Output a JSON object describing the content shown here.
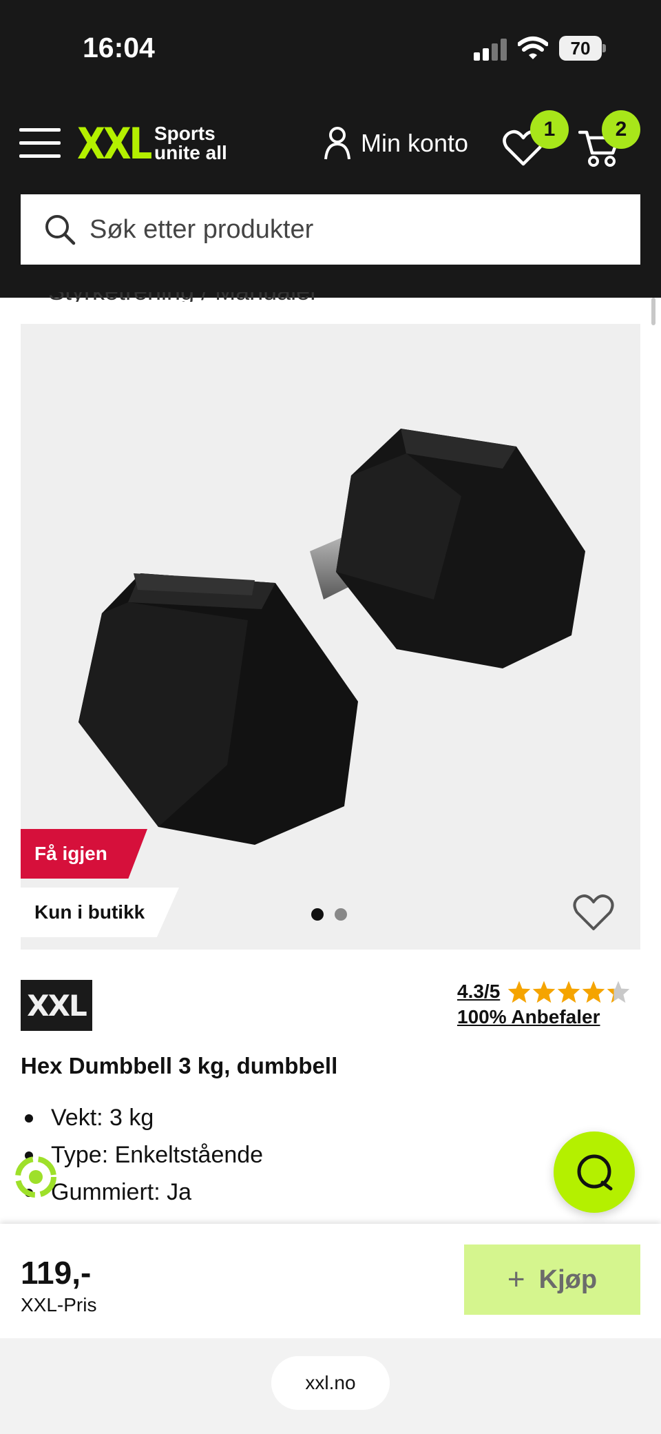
{
  "status_bar": {
    "time": "16:04",
    "battery": "70"
  },
  "header": {
    "logo_main": "XXL",
    "logo_tagline_1": "Sports",
    "logo_tagline_2": "unite all",
    "account_label": "Min konto",
    "wishlist_count": "1",
    "cart_count": "2",
    "search_placeholder": "Søk etter produkter",
    "breadcrumb_peek": "Styrketrening / Manualer",
    "icons": [
      "menu-icon",
      "user-icon",
      "heart-icon",
      "cart-icon",
      "search-icon"
    ],
    "colors": {
      "background": "#181818",
      "accent": "#b4f000"
    }
  },
  "product_media": {
    "badge_again": "Få igjen",
    "badge_store": "Kun i butikk",
    "image_count": 2,
    "active_image": 1
  },
  "product": {
    "brand": "XXL",
    "rating": "4.3/5",
    "rating_value": 4.3,
    "recommend": "100% Anbefaler",
    "title": "Hex Dumbbell 3 kg, dumbbell",
    "specs": [
      "Vekt: 3 kg",
      "Type: Enkeltstående",
      "Gummiert: Ja"
    ]
  },
  "buy_bar": {
    "price": "119,-",
    "price_label": "XXL-Pris",
    "buy_label": "Kjøp",
    "button_color": "#d5f58e"
  },
  "browser": {
    "url": "xxl.no"
  }
}
